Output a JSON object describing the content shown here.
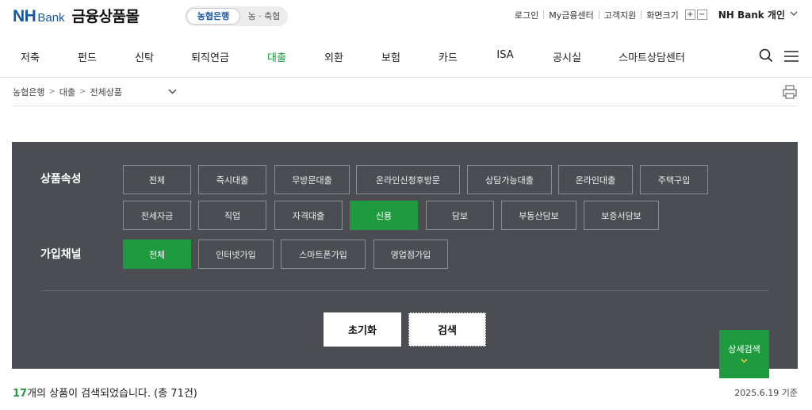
{
  "header": {
    "logo_nh": "NH",
    "logo_bank": "Bank",
    "title": "금융상품몰",
    "toggle_active": "농협은행",
    "toggle_inactive": "농 · 축협",
    "util_links": [
      "로그인",
      "My금융센터",
      "고객지원",
      "화면크기"
    ],
    "zoom_in": "+",
    "zoom_out": "−",
    "personal_label": "NH Bank 개인",
    "brand_color": "#1559a8"
  },
  "gnb": {
    "items": [
      "저축",
      "펀드",
      "신탁",
      "퇴직연금",
      "대출",
      "외환",
      "보험",
      "카드",
      "ISA",
      "공시실",
      "스마트상담센터"
    ],
    "active": "대출",
    "active_color": "#1b9a3c",
    "icons": [
      "search-icon",
      "hamburger-menu-icon"
    ]
  },
  "breadcrumb": {
    "items": [
      "농협은행",
      "대출",
      "전체상품"
    ],
    "separator": ">",
    "dropdown_icon": "chevron-down-icon",
    "print_icon": "print-icon"
  },
  "filter": {
    "attr_label": "상품속성",
    "attr_options": [
      "전체",
      "즉시대출",
      "무방문대출",
      "온라인신청후방문",
      "상담가능대출",
      "온라인대출",
      "주택구입",
      "전세자금",
      "직업",
      "자격대출",
      "신용",
      "담보",
      "부동산담보",
      "보증서담보"
    ],
    "attr_selected": "신용",
    "channel_label": "가입채널",
    "channel_options": [
      "전체",
      "인터넷가입",
      "스마트폰가입",
      "영업점가입"
    ],
    "channel_selected": "전체",
    "reset_label": "초기화",
    "search_label": "검색",
    "panel_color": "#4c4d52",
    "selected_color": "#1e9b3f"
  },
  "detail_search": {
    "label": "상세검색",
    "arrow_icon": "chevron-down-icon"
  },
  "result": {
    "count": "17",
    "text": "개의 상품이 검색되었습니다. (총 71건)",
    "date": "2025.6.19 기준"
  }
}
